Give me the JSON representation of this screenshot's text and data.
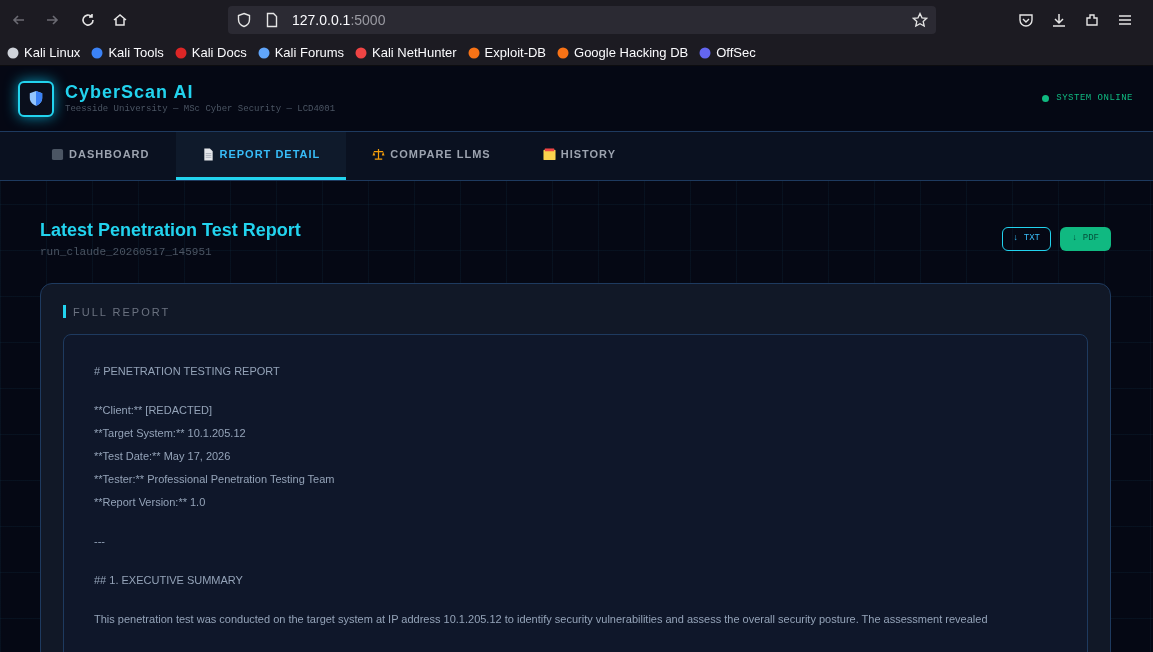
{
  "browser": {
    "url_host": "127.0.0.1",
    "url_port": ":5000",
    "bookmarks": [
      {
        "label": "Kali Linux",
        "color": "#cfd3da"
      },
      {
        "label": "Kali Tools",
        "color": "#3b82f6"
      },
      {
        "label": "Kali Docs",
        "color": "#dc2626"
      },
      {
        "label": "Kali Forums",
        "color": "#60a5fa"
      },
      {
        "label": "Kali NetHunter",
        "color": "#ef4444"
      },
      {
        "label": "Exploit-DB",
        "color": "#f97316"
      },
      {
        "label": "Google Hacking DB",
        "color": "#f97316"
      },
      {
        "label": "OffSec",
        "color": "#6366f1"
      }
    ]
  },
  "app": {
    "title": "CyberScan AI",
    "subtitle": "Teesside University — MSc Cyber Security — LCD4001",
    "status": "SYSTEM ONLINE"
  },
  "tabs": [
    {
      "label": "DASHBOARD",
      "kind": "dashboard",
      "selected": false
    },
    {
      "label": "REPORT DETAIL",
      "kind": "document",
      "selected": true
    },
    {
      "label": "COMPARE LLMS",
      "kind": "scales",
      "selected": false
    },
    {
      "label": "HISTORY",
      "kind": "folder",
      "selected": false
    }
  ],
  "page": {
    "title": "Latest Penetration Test Report",
    "run_id": "run_claude_20260517_145951",
    "buttons": [
      {
        "label": "↓ TXT",
        "kind": "outline"
      },
      {
        "label": "↓ PDF",
        "kind": "solid"
      }
    ]
  },
  "report": {
    "heading": "FULL REPORT",
    "blocks": [
      [
        "# PENETRATION TESTING REPORT"
      ],
      [
        "**Client:** [REDACTED]",
        "**Target System:** 10.1.205.12",
        "**Test Date:** May 17, 2026",
        "**Tester:** Professional Penetration Testing Team",
        "**Report Version:** 1.0"
      ],
      [
        "---"
      ],
      [
        "## 1. EXECUTIVE SUMMARY"
      ],
      [
        "This penetration test was conducted on the target system at IP address 10.1.205.12 to identify security vulnerabilities and assess the overall security posture. The assessment revealed"
      ]
    ]
  }
}
